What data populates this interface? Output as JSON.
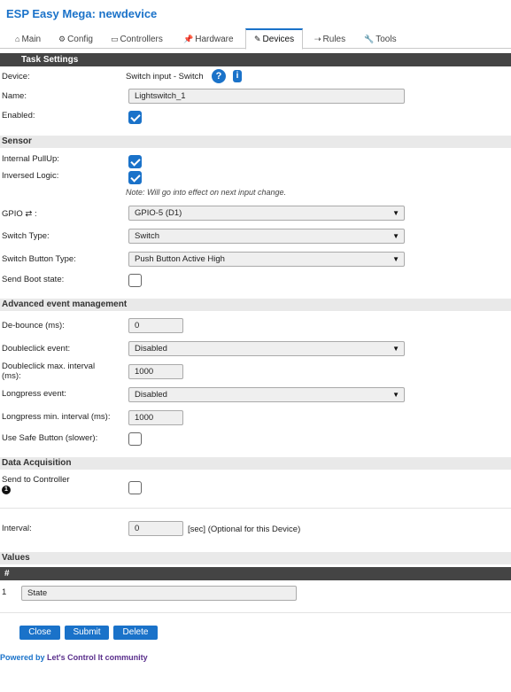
{
  "app_title": "ESP Easy Mega: newdevice",
  "tabs": [
    {
      "label": "Main",
      "icon": "⌂"
    },
    {
      "label": "Config",
      "icon": "⚙"
    },
    {
      "label": "Controllers",
      "icon": "▭"
    },
    {
      "label": "Hardware",
      "icon": "📌"
    },
    {
      "label": "Devices",
      "icon": "✎"
    },
    {
      "label": "Rules",
      "icon": "⇢"
    },
    {
      "label": "Tools",
      "icon": "🔧"
    }
  ],
  "active_tab": "Devices",
  "task_settings": {
    "header": "Task Settings",
    "device_label": "Device:",
    "device_value": "Switch input - Switch",
    "help_icon": "?",
    "info_icon": "i",
    "name_label": "Name:",
    "name_value": "Lightswitch_1",
    "enabled_label": "Enabled:",
    "enabled": true
  },
  "sensor": {
    "header": "Sensor",
    "pullup_label": "Internal PullUp:",
    "pullup": true,
    "inversed_label": "Inversed Logic:",
    "inversed": true,
    "note": "Note: Will go into effect on next input change.",
    "gpio_label": "GPIO ⇄ :",
    "gpio_value": "GPIO-5 (D1)",
    "switch_type_label": "Switch Type:",
    "switch_type_value": "Switch",
    "button_type_label": "Switch Button Type:",
    "button_type_value": "Push Button Active High",
    "boot_state_label": "Send Boot state:",
    "boot_state": false
  },
  "advanced": {
    "header": "Advanced event management",
    "debounce_label": "De-bounce (ms):",
    "debounce_value": "0",
    "dblclick_label": "Doubleclick event:",
    "dblclick_value": "Disabled",
    "dblclick_interval_label_1": "Doubleclick max. interval",
    "dblclick_interval_label_2": "(ms):",
    "dblclick_interval_value": "1000",
    "longpress_label": "Longpress event:",
    "longpress_value": "Disabled",
    "longpress_interval_label": "Longpress min. interval (ms):",
    "longpress_interval_value": "1000",
    "safe_button_label": "Use Safe Button (slower):",
    "safe_button": false
  },
  "data_acquisition": {
    "header": "Data Acquisition",
    "send_label": "Send to Controller",
    "controller_number": "1",
    "send": false,
    "interval_label": "Interval:",
    "interval_value": "0",
    "interval_suffix": "[sec] (Optional for this Device)"
  },
  "values": {
    "header": "Values",
    "column_header": "#",
    "rows": [
      {
        "index": "1",
        "name": "State"
      }
    ]
  },
  "buttons": {
    "close": "Close",
    "submit": "Submit",
    "delete": "Delete"
  },
  "footer": {
    "prefix": "Powered by",
    "link": "Let's Control It community"
  },
  "colors": {
    "accent": "#1a72c9",
    "dark_band": "#444444",
    "light_band": "#e9e9e9"
  }
}
